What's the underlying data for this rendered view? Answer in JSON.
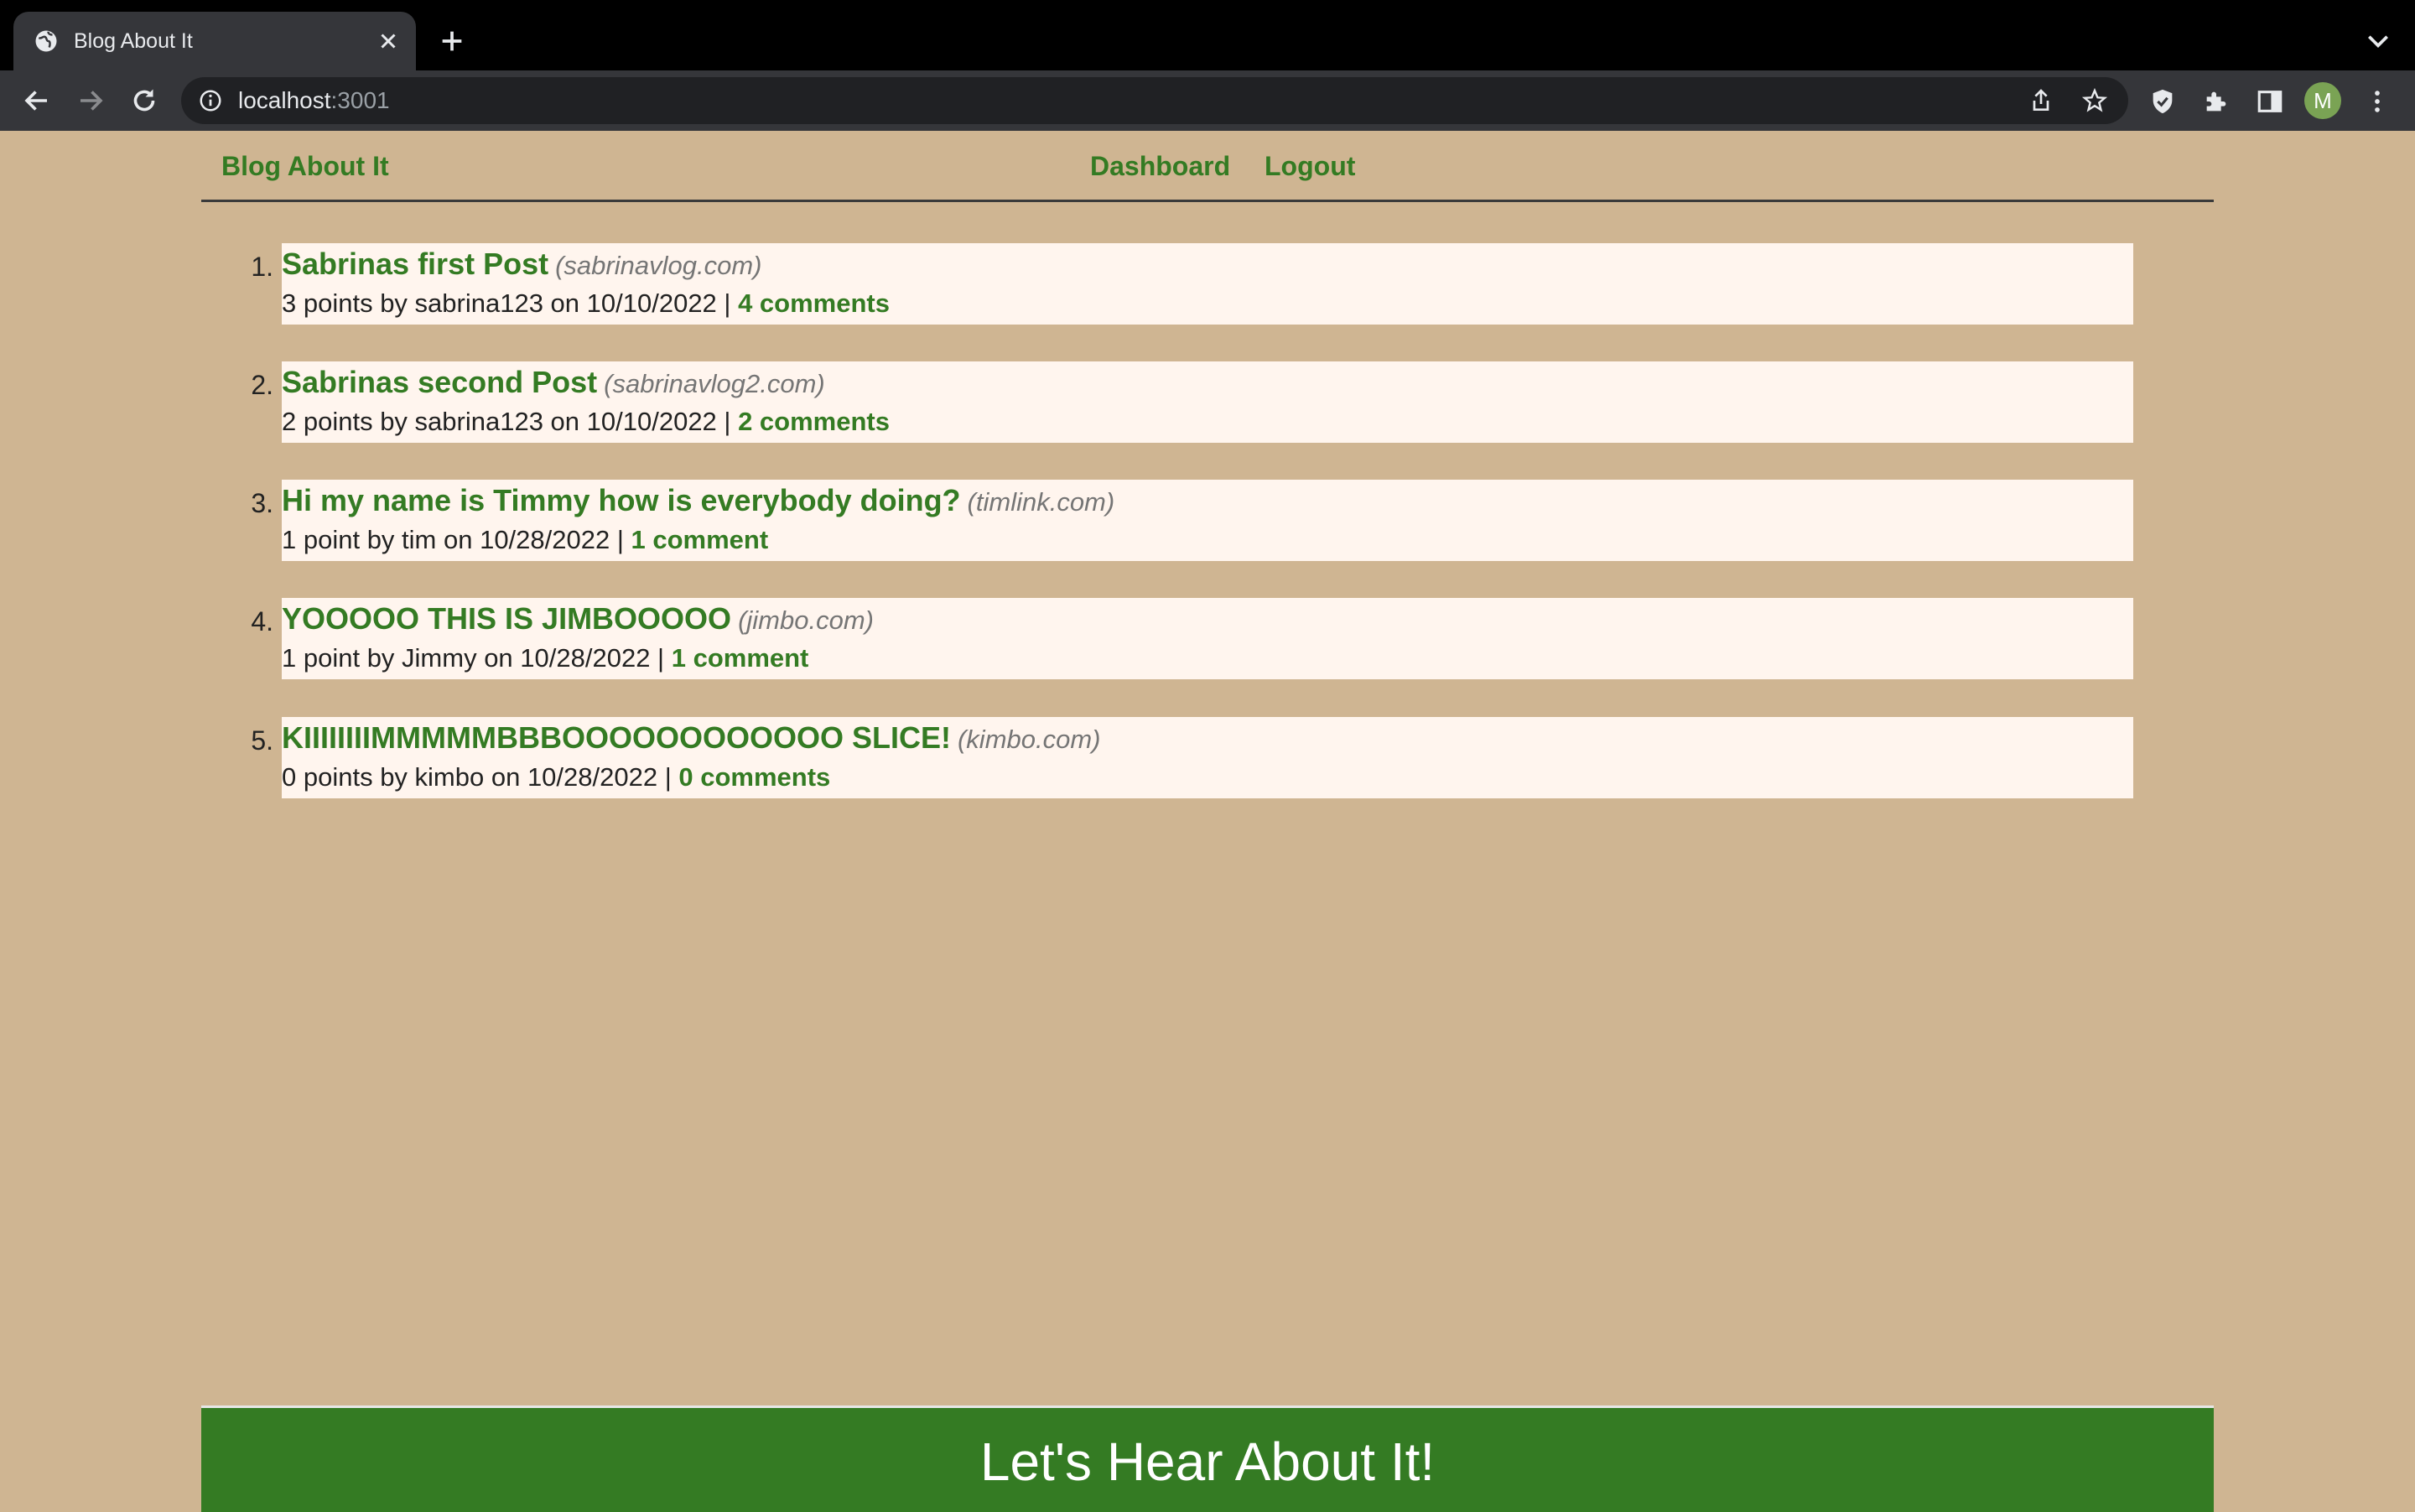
{
  "browser": {
    "tab_title": "Blog About It",
    "url_host": "localhost",
    "url_port": ":3001",
    "profile_initial": "M",
    "icons": [
      "globe-icon",
      "close-icon",
      "plus-icon",
      "chevron-down-icon",
      "back-icon",
      "forward-icon",
      "reload-icon",
      "info-icon",
      "share-icon",
      "star-icon",
      "shield-icon",
      "puzzle-icon",
      "sidebar-icon",
      "kebab-menu-icon"
    ]
  },
  "header": {
    "brand": "Blog About It",
    "nav": [
      "Dashboard",
      "Logout"
    ]
  },
  "posts": [
    {
      "number": "1.",
      "title": "Sabrinas first Post",
      "domain": "(sabrinavlog.com)",
      "meta": "3 points by sabrina123 on 10/10/2022 | ",
      "comments": "4 comments"
    },
    {
      "number": "2.",
      "title": "Sabrinas second Post",
      "domain": "(sabrinavlog2.com)",
      "meta": "2 points by sabrina123 on 10/10/2022 | ",
      "comments": "2 comments"
    },
    {
      "number": "3.",
      "title": "Hi my name is Timmy how is everybody doing?",
      "domain": "(timlink.com)",
      "meta": "1 point by tim on 10/28/2022 | ",
      "comments": "1 comment"
    },
    {
      "number": "4.",
      "title": "YOOOOO THIS IS JIMBOOOOO",
      "domain": "(jimbo.com)",
      "meta": "1 point by Jimmy on 10/28/2022 | ",
      "comments": "1 comment"
    },
    {
      "number": "5.",
      "title": "KIIIIIIIIMMMMMBBBOOOOOOOOOOOO SLICE!",
      "domain": "(kimbo.com)",
      "meta": "0 points by kimbo on 10/28/2022 | ",
      "comments": "0 comments"
    }
  ],
  "footer": {
    "text": "Let's Hear About It!"
  },
  "colors": {
    "page_bg": "#cfb592",
    "accent_green": "#347b23",
    "card_bg": "#fff5ee"
  }
}
